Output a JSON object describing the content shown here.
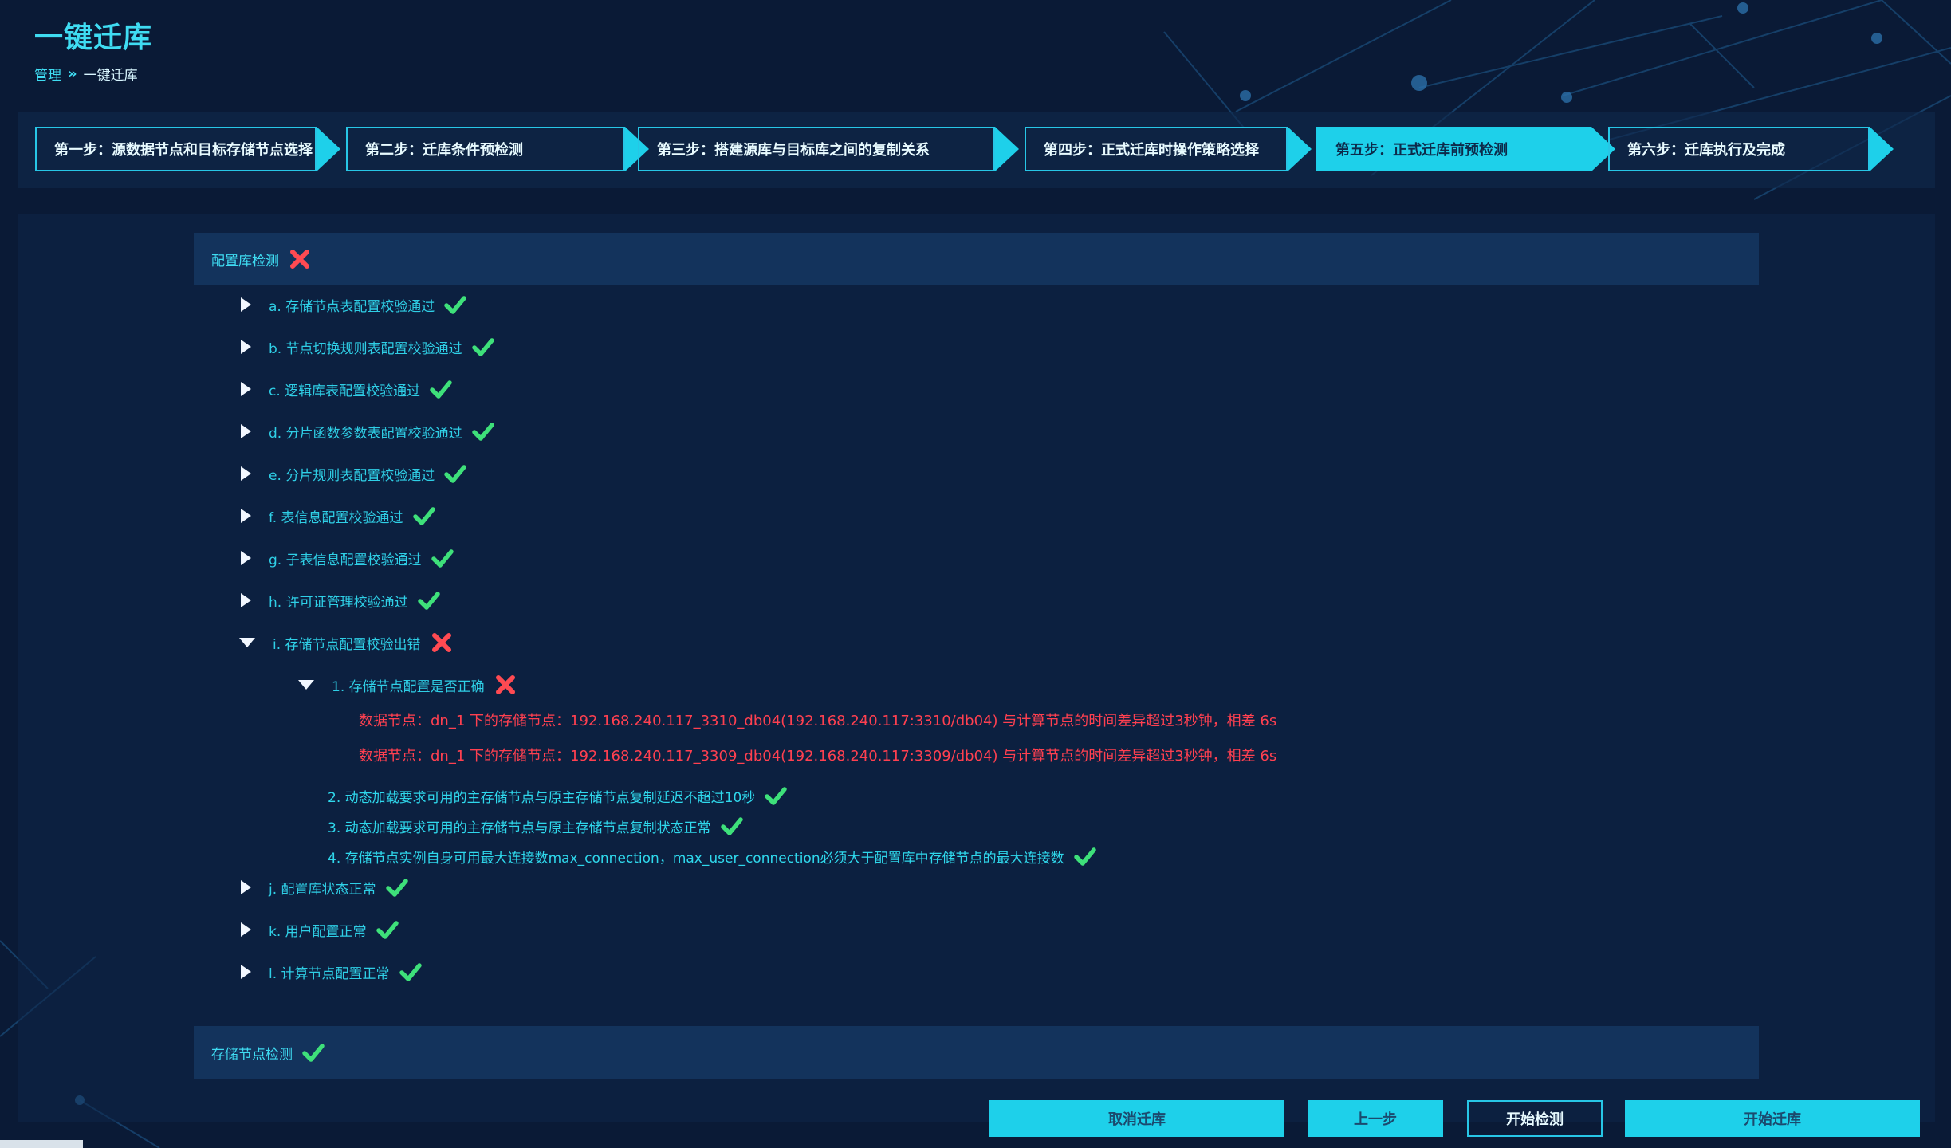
{
  "header": {
    "title": "一键迁库",
    "breadcrumb": {
      "root": "管理",
      "separator": "»",
      "current": "一键迁库"
    }
  },
  "steps": [
    {
      "label": "第一步：源数据节点和目标存储节点选择",
      "active": false
    },
    {
      "label": "第二步：迁库条件预检测",
      "active": false
    },
    {
      "label": "第三步：搭建源库与目标库之间的复制关系",
      "active": false
    },
    {
      "label": "第四步：正式迁库时操作策略选择",
      "active": false
    },
    {
      "label": "第五步：正式迁库前预检测",
      "active": true
    },
    {
      "label": "第六步：迁库执行及完成",
      "active": false
    }
  ],
  "config_check": {
    "label": "配置库检测",
    "status": "fail",
    "items": [
      {
        "label": "a. 存储节点表配置校验通过",
        "status": "pass",
        "expanded": false
      },
      {
        "label": "b. 节点切换规则表配置校验通过",
        "status": "pass",
        "expanded": false
      },
      {
        "label": "c. 逻辑库表配置校验通过",
        "status": "pass",
        "expanded": false
      },
      {
        "label": "d. 分片函数参数表配置校验通过",
        "status": "pass",
        "expanded": false
      },
      {
        "label": "e. 分片规则表配置校验通过",
        "status": "pass",
        "expanded": false
      },
      {
        "label": "f. 表信息配置校验通过",
        "status": "pass",
        "expanded": false
      },
      {
        "label": "g. 子表信息配置校验通过",
        "status": "pass",
        "expanded": false
      },
      {
        "label": "h. 许可证管理校验通过",
        "status": "pass",
        "expanded": false
      },
      {
        "label": "i. 存储节点配置校验出错",
        "status": "fail",
        "expanded": true
      },
      {
        "label": "j. 配置库状态正常",
        "status": "pass",
        "expanded": false
      },
      {
        "label": "k. 用户配置正常",
        "status": "pass",
        "expanded": false
      },
      {
        "label": "l. 计算节点配置正常",
        "status": "pass",
        "expanded": false
      }
    ],
    "sub_item": {
      "label": "1. 存储节点配置是否正确",
      "status": "fail",
      "errors": [
        "数据节点：dn_1 下的存储节点：192.168.240.117_3310_db04(192.168.240.117:3310/db04) 与计算节点的时间差异超过3秒钟，相差 6s",
        "数据节点：dn_1 下的存储节点：192.168.240.117_3309_db04(192.168.240.117:3309/db04) 与计算节点的时间差异超过3秒钟，相差 6s"
      ]
    },
    "other_sub_items": [
      {
        "label": "2. 动态加载要求可用的主存储节点与原主存储节点复制延迟不超过10秒",
        "status": "pass"
      },
      {
        "label": "3. 动态加载要求可用的主存储节点与原主存储节点复制状态正常",
        "status": "pass"
      },
      {
        "label": "4. 存储节点实例自身可用最大连接数max_connection，max_user_connection必须大于配置库中存储节点的最大连接数",
        "status": "pass"
      }
    ]
  },
  "storage_check": {
    "label": "存储节点检测",
    "status": "pass"
  },
  "buttons": {
    "cancel": "取消迁库",
    "prev": "上一步",
    "start_check": "开始检测",
    "start_migrate": "开始迁库"
  },
  "colors": {
    "accent": "#1ed0ea",
    "pass": "#3ee07a",
    "fail": "#ff4a52",
    "error_text": "#ff4050"
  }
}
